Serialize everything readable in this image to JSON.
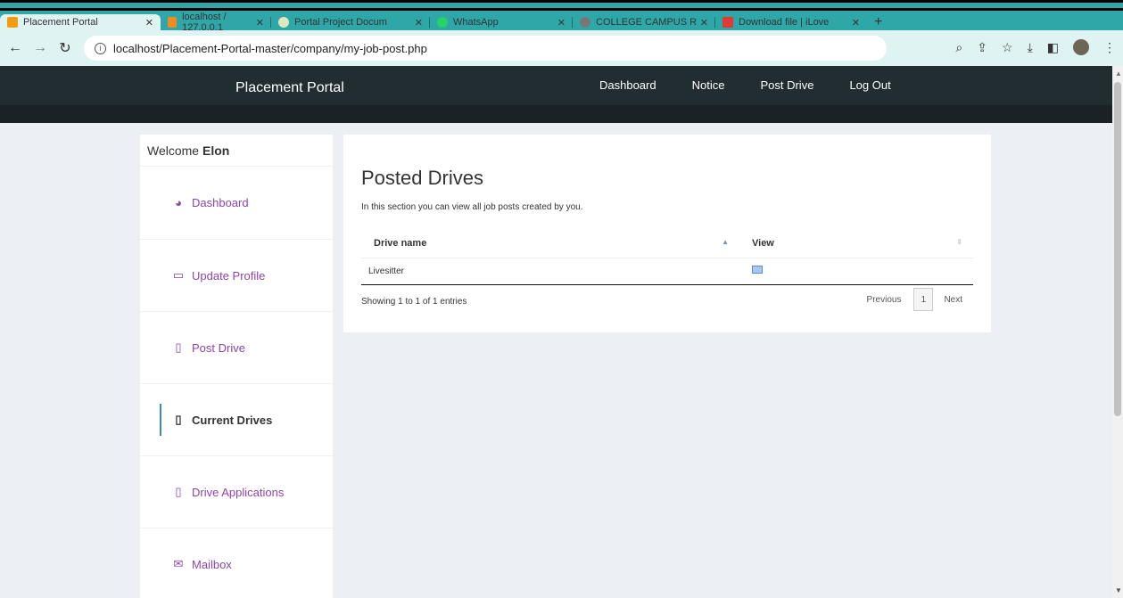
{
  "browser": {
    "tabs": [
      {
        "label": "Placement Portal",
        "favicon_color": "#f39c12"
      },
      {
        "label": "localhost / 127.0.0.1",
        "favicon_color": "#f08a24"
      },
      {
        "label": "Portal Project Docum",
        "favicon_color": "#dfe7c0"
      },
      {
        "label": "WhatsApp",
        "favicon_color": "#25d366"
      },
      {
        "label": "COLLEGE CAMPUS R",
        "favicon_color": "#777777"
      },
      {
        "label": "Download file | iLove",
        "favicon_color": "#e53935"
      }
    ],
    "url": "localhost/Placement-Portal-master/company/my-job-post.php"
  },
  "navbar": {
    "brand": "Placement Portal",
    "links": [
      "Dashboard",
      "Notice",
      "Post Drive",
      "Log Out"
    ]
  },
  "sidebar": {
    "welcome_prefix": "Welcome",
    "user": "Elon",
    "items": [
      {
        "label": "Dashboard",
        "icon": "dashboard-icon"
      },
      {
        "label": "Update Profile",
        "icon": "monitor-icon"
      },
      {
        "label": "Post Drive",
        "icon": "file-icon"
      },
      {
        "label": "Current Drives",
        "icon": "file-icon",
        "active": true
      },
      {
        "label": "Drive Applications",
        "icon": "file-icon"
      },
      {
        "label": "Mailbox",
        "icon": "envelope-icon"
      }
    ]
  },
  "main": {
    "title": "Posted Drives",
    "description": "In this section you can view all job posts created by you.",
    "table": {
      "headers": [
        "Drive name",
        "View"
      ],
      "rows": [
        {
          "drive_name": "Livesitter"
        }
      ]
    },
    "showing": "Showing 1 to 1 of 1 entries",
    "pager": {
      "prev": "Previous",
      "page": "1",
      "next": "Next"
    }
  }
}
